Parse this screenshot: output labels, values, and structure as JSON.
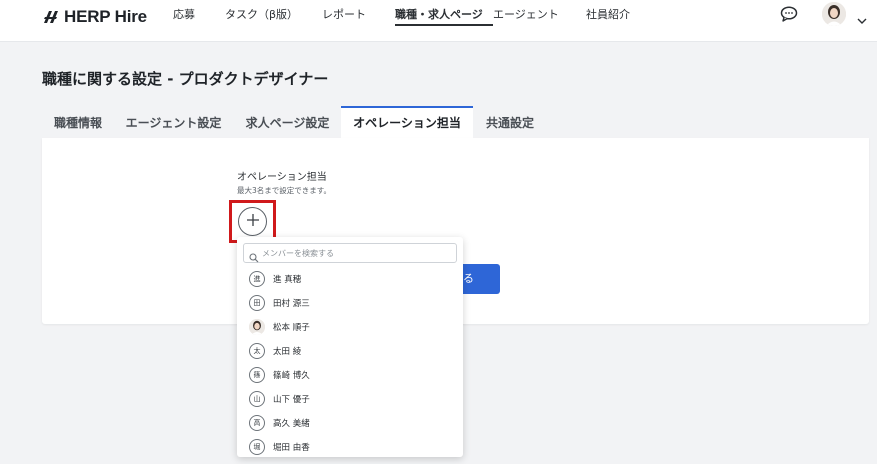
{
  "header": {
    "brand": "HERP Hire",
    "nav": [
      "応募",
      "タスク（β版）",
      "レポート",
      "職種・求人ページ",
      "エージェント",
      "社員紹介"
    ],
    "active_nav": "職種・求人ページ"
  },
  "page": {
    "title": "職種に関する設定 - プロダクトデザイナー"
  },
  "tabs": [
    "職種情報",
    "エージェント設定",
    "求人ページ設定",
    "オペレーション担当",
    "共通設定"
  ],
  "active_tab": "オペレーション担当",
  "operation": {
    "label": "オペレーション担当",
    "help": "最大3名まで設定できます。",
    "add_symbol": "+",
    "save_label_visible": "る"
  },
  "dropdown": {
    "search_placeholder": "メンバーを検索する",
    "members": [
      {
        "initial": "進",
        "name": "進 真穂"
      },
      {
        "initial": "田",
        "name": "田村 源三"
      },
      {
        "initial": "",
        "name": "松本 順子",
        "photo": true
      },
      {
        "initial": "太",
        "name": "太田 綾"
      },
      {
        "initial": "篠",
        "name": "篠崎 博久"
      },
      {
        "initial": "山",
        "name": "山下 優子"
      },
      {
        "initial": "高",
        "name": "高久 美緒"
      },
      {
        "initial": "堀",
        "name": "堀田 由香"
      }
    ]
  },
  "colors": {
    "accent": "#2e66d7",
    "highlight": "#d0191b",
    "background": "#f2f3f5"
  }
}
